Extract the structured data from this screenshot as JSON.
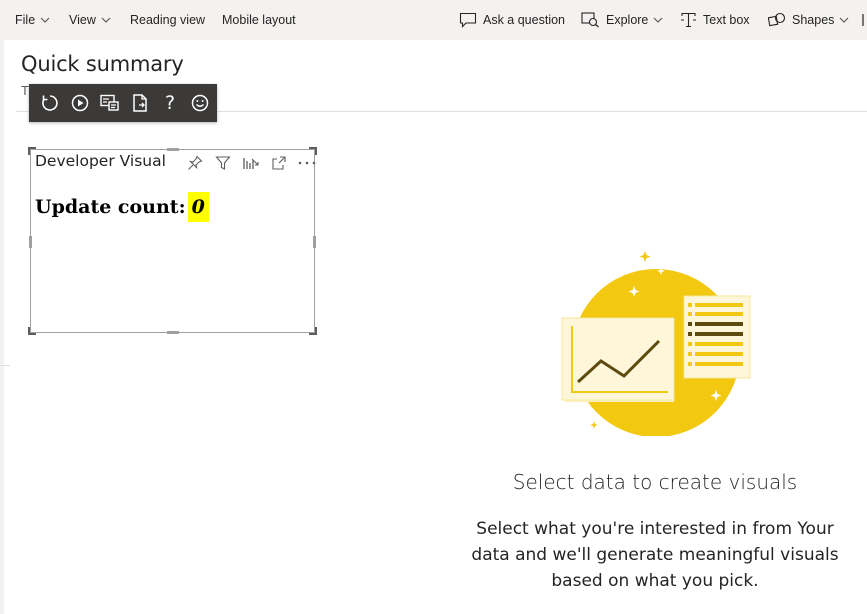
{
  "topbar": {
    "file": "File",
    "view": "View",
    "reading_view": "Reading view",
    "mobile_layout": "Mobile layout",
    "ask_question": "Ask a question",
    "explore": "Explore",
    "text_box": "Text box",
    "shapes": "Shapes",
    "icons": {
      "ask_question": "speech-bubble-icon",
      "explore": "explore-icon",
      "text_box": "text-box-icon",
      "shapes": "shapes-icon"
    }
  },
  "page": {
    "title": "Quick summary",
    "subtitle_fragment": "T"
  },
  "dev_toolbar": {
    "icons": [
      "reload-icon",
      "play-icon",
      "data-view-icon",
      "document-icon",
      "help-icon",
      "smiley-icon"
    ],
    "help_glyph": "?"
  },
  "visual": {
    "title": "Developer Visual",
    "label": "Update count:",
    "count": "0",
    "header_icons": [
      "pin-icon",
      "filter-icon",
      "focus-chart-icon",
      "expand-icon",
      "more-options-icon"
    ]
  },
  "empty_state": {
    "title": "Select data to create visuals",
    "description": "Select what you're interested in from Your data and we'll generate meaningful visuals based on what you pick."
  },
  "colors": {
    "topbar_bg": "#f3f2f1",
    "dev_toolbar_bg": "#3b3a39",
    "count_highlight": "#ffff00",
    "illustration_yellow": "#f2c811"
  }
}
